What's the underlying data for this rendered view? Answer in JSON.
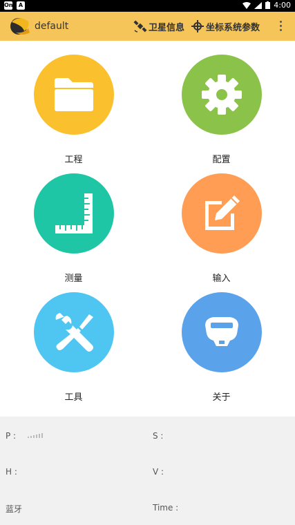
{
  "statusbar": {
    "time": "4:00"
  },
  "toolbar": {
    "title": "default",
    "satellite_label": "卫星信息",
    "coord_label": "坐标系统参数"
  },
  "tiles": [
    {
      "label": "工程",
      "color": "#fbc02d",
      "icon": "folder-icon"
    },
    {
      "label": "配置",
      "color": "#8bc34a",
      "icon": "gear-icon"
    },
    {
      "label": "测量",
      "color": "#1fc6a5",
      "icon": "ruler-icon"
    },
    {
      "label": "输入",
      "color": "#ff9d55",
      "icon": "edit-icon"
    },
    {
      "label": "工具",
      "color": "#4ec6f1",
      "icon": "tools-icon"
    },
    {
      "label": "关于",
      "color": "#5aa3ea",
      "icon": "receiver-icon"
    }
  ],
  "info": {
    "p_label": "P :",
    "s_label": "S :",
    "h_label": "H :",
    "v_label": "V :",
    "bt_label": "蓝牙",
    "time_label": "Time :"
  }
}
